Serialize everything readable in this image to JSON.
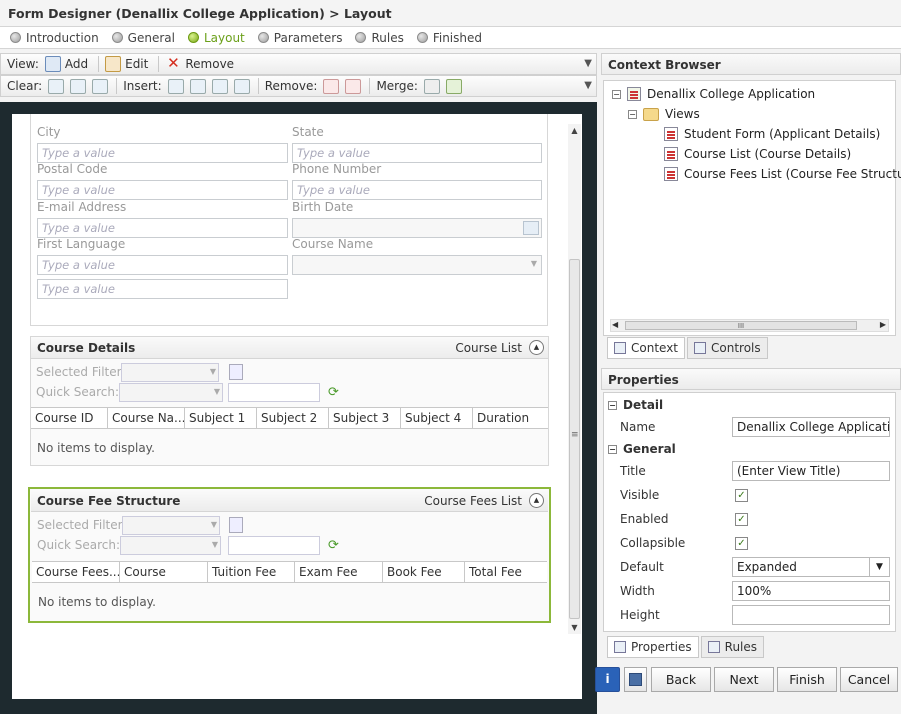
{
  "window": {
    "title": "Form Designer (Denallix College Application) > Layout"
  },
  "wizard": {
    "steps": [
      {
        "label": "Introduction",
        "active": false
      },
      {
        "label": "General",
        "active": false
      },
      {
        "label": "Layout",
        "active": true
      },
      {
        "label": "Parameters",
        "active": false
      },
      {
        "label": "Rules",
        "active": false
      },
      {
        "label": "Finished",
        "active": false
      }
    ]
  },
  "toolbar1": {
    "view_label": "View:",
    "add": "Add",
    "edit": "Edit",
    "remove": "Remove"
  },
  "toolbar2": {
    "clear_label": "Clear:",
    "insert_label": "Insert:",
    "remove_label": "Remove:",
    "merge_label": "Merge:"
  },
  "form": {
    "placeholder": "Type a value",
    "fields": {
      "city": "City",
      "state": "State",
      "postal": "Postal Code",
      "phone": "Phone Number",
      "email": "E-mail Address",
      "birth": "Birth Date",
      "language": "First Language",
      "course": "Course Name"
    }
  },
  "course_details": {
    "title": "Course Details",
    "view_name": "Course List",
    "selected_filter": "Selected Filter:",
    "quick_search": "Quick Search:",
    "columns": [
      "Course ID",
      "Course Na...",
      "Subject 1",
      "Subject 2",
      "Subject 3",
      "Subject 4",
      "Duration"
    ],
    "empty": "No items to display."
  },
  "course_fee": {
    "title": "Course Fee Structure",
    "view_name": "Course Fees List",
    "selected_filter": "Selected Filter:",
    "quick_search": "Quick Search:",
    "columns": [
      "Course Fees...",
      "Course",
      "Tuition Fee",
      "Exam Fee",
      "Book Fee",
      "Total Fee"
    ],
    "empty": "No items to display."
  },
  "context_browser": {
    "title": "Context Browser",
    "root": "Denallix College Application",
    "views_label": "Views",
    "views": [
      "Student Form (Applicant Details)",
      "Course List (Course Details)",
      "Course Fees List (Course Fee Structu"
    ],
    "tabs": [
      "Context",
      "Controls"
    ],
    "hscroll_glyph": "III"
  },
  "properties": {
    "title": "Properties",
    "group_detail": "Detail",
    "group_general": "General",
    "name_label": "Name",
    "name_value": "Denallix College Application",
    "title_label": "Title",
    "title_value": "(Enter View Title)",
    "visible_label": "Visible",
    "enabled_label": "Enabled",
    "collapsible_label": "Collapsible",
    "default_label": "Default",
    "default_value": "Expanded",
    "width_label": "Width",
    "width_value": "100%",
    "height_label": "Height",
    "height_value": "",
    "tabs": [
      "Properties",
      "Rules"
    ]
  },
  "footer": {
    "info": "i",
    "back": "Back",
    "next": "Next",
    "finish": "Finish",
    "cancel": "Cancel"
  },
  "colors": {
    "accent_green": "#8cb83a",
    "active_step": "#6ba01a"
  }
}
